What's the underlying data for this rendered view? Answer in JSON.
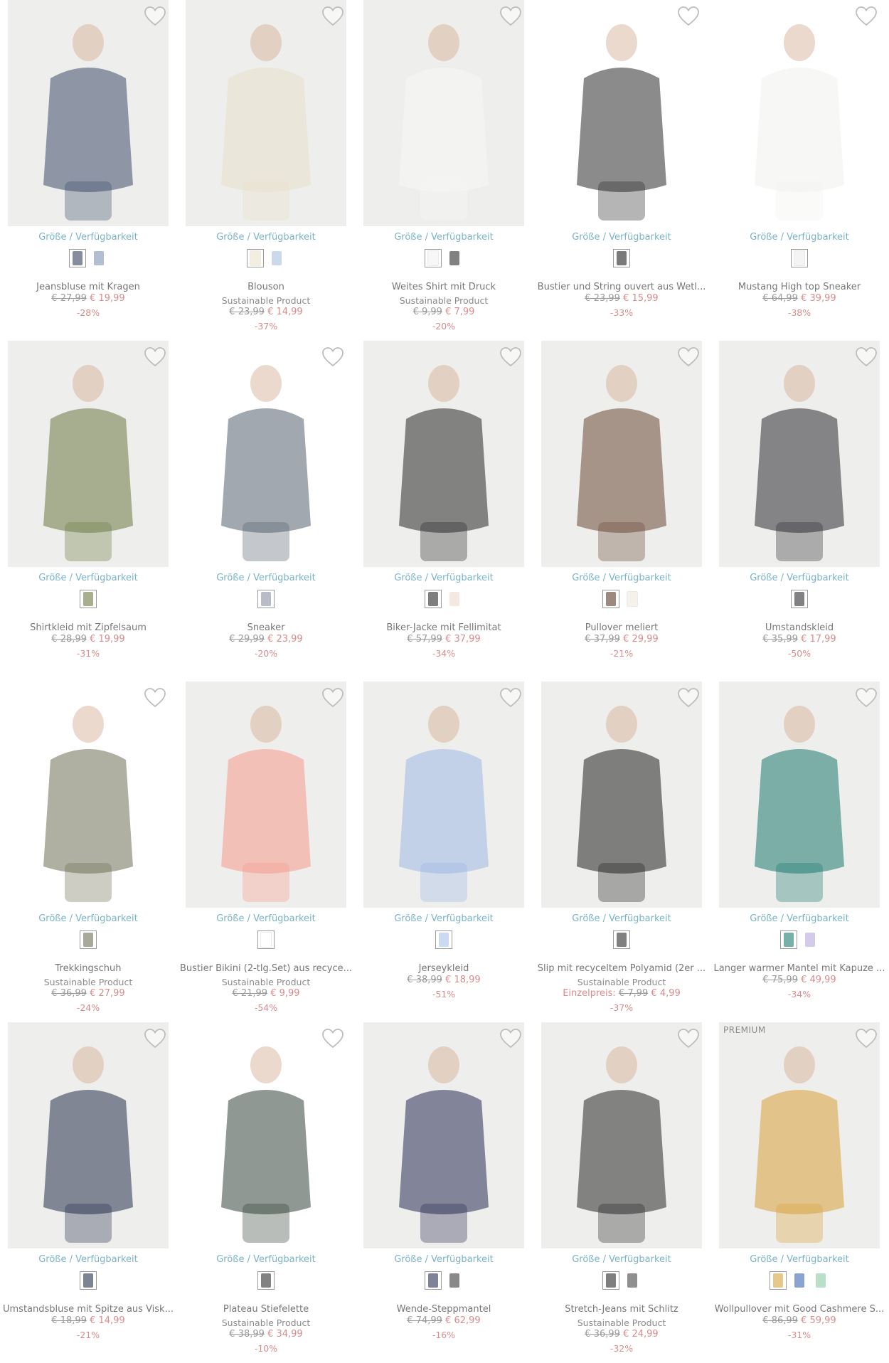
{
  "labels": {
    "size_link": "Größe / Verfügbarkeit",
    "sustainable": "Sustainable Product",
    "premium": "PREMIUM",
    "unit_price": "Einzelpreis:"
  },
  "colors": {
    "price_new": "#d98c8c",
    "link": "#7ab3c9",
    "muted": "#8a8a8a"
  },
  "icons": {
    "wishlist": "heart-outline-icon"
  },
  "products": [
    {
      "name": "Jeansbluse mit Kragen",
      "sustainable": false,
      "old": "€ 27,99",
      "new": "€ 19,99",
      "disc": "-28%",
      "img": "#3f4f6e",
      "bg": "#eeeeec",
      "swatches": [
        "#33415e",
        "#7f93b3"
      ]
    },
    {
      "name": "Blouson",
      "sustainable": true,
      "old": "€ 23,99",
      "new": "€ 14,99",
      "disc": "-37%",
      "img": "#e8e0cc",
      "bg": "#eeeeec",
      "swatches": [
        "#ece3c8",
        "#a9c2dc"
      ]
    },
    {
      "name": "Weites Shirt mit Druck",
      "sustainable": true,
      "old": "€ 9,99",
      "new": "€ 7,99",
      "disc": "-20%",
      "img": "#f7f7f7",
      "bg": "#eeeeec",
      "swatches": [
        "#f3f3f3",
        "#2d2d2d"
      ]
    },
    {
      "name": "Bustier und String ouvert aus Wetl...",
      "sustainable": false,
      "old": "€ 23,99",
      "new": "€ 15,99",
      "disc": "-33%",
      "img": "#2b2b2b",
      "bg": "#ffffff",
      "swatches": [
        "#222222"
      ]
    },
    {
      "name": "Mustang High top Sneaker",
      "sustainable": false,
      "old": "€ 64,99",
      "new": "€ 39,99",
      "disc": "-38%",
      "img": "#f1f1ef",
      "bg": "#ffffff",
      "swatches": [
        "#eeeeee"
      ]
    },
    {
      "name": "Shirtkleid mit Zipfelsaum",
      "sustainable": false,
      "old": "€ 28,99",
      "new": "€ 19,99",
      "disc": "-31%",
      "img": "#6e7a45",
      "bg": "#eeeeec",
      "swatches": [
        "#6e7a45"
      ]
    },
    {
      "name": "Sneaker",
      "sustainable": false,
      "old": "€ 29,99",
      "new": "€ 23,99",
      "disc": "-20%",
      "img": "#556070",
      "bg": "#ffffff",
      "swatches": [
        "#8890a0"
      ]
    },
    {
      "name": "Biker-Jacke mit Fellimitat",
      "sustainable": false,
      "old": "€ 57,99",
      "new": "€ 37,99",
      "disc": "-34%",
      "img": "#2a2a2a",
      "bg": "#eeeeec",
      "swatches": [
        "#2a2a2a",
        "#ecd9cf"
      ]
    },
    {
      "name": "Pullover meliert",
      "sustainable": false,
      "old": "€ 37,99",
      "new": "€ 29,99",
      "disc": "-21%",
      "img": "#6b4a36",
      "bg": "#eeeeec",
      "swatches": [
        "#5b3b2b",
        "#efe9df"
      ]
    },
    {
      "name": "Umstandskleid",
      "sustainable": false,
      "old": "€ 35,99",
      "new": "€ 17,99",
      "disc": "-50%",
      "img": "#2e2e34",
      "bg": "#eeeeec",
      "swatches": [
        "#2e2e34"
      ]
    },
    {
      "name": "Trekkingschuh",
      "sustainable": true,
      "old": "€ 36,99",
      "new": "€ 27,99",
      "disc": "-24%",
      "img": "#6f7056",
      "bg": "#ffffff",
      "swatches": [
        "#6f7056"
      ]
    },
    {
      "name": "Bustier Bikini (2-tlg.Set) aus recyce...",
      "sustainable": true,
      "old": "€ 21,99",
      "new": "€ 9,99",
      "disc": "-54%",
      "img": "#f59a8c",
      "bg": "#eeeeec",
      "swatches": [
        "#ffffff"
      ]
    },
    {
      "name": "Jerseykleid",
      "sustainable": false,
      "old": "€ 38,99",
      "new": "€ 18,99",
      "disc": "-51%",
      "img": "#9fb8e6",
      "bg": "#eeeeec",
      "swatches": [
        "#a9c0ea"
      ]
    },
    {
      "name": "Slip mit recyceltem Polyamid (2er ...",
      "sustainable": true,
      "old": "€ 7,99",
      "new": "€ 4,99",
      "disc": "-37%",
      "unit": true,
      "img": "#232323",
      "bg": "#eeeeec",
      "swatches": [
        "#2b2b2b"
      ]
    },
    {
      "name": "Langer warmer Mantel mit Kapuze ...",
      "sustainable": false,
      "old": "€ 75,99",
      "new": "€ 49,99",
      "disc": "-34%",
      "img": "#1c7a70",
      "bg": "#eeeeec",
      "swatches": [
        "#1c7a70",
        "#b8a7dc"
      ]
    },
    {
      "name": "Umstandsbluse mit Spitze aus Visk...",
      "sustainable": false,
      "old": "€ 18,99",
      "new": "€ 14,99",
      "disc": "-21%",
      "img": "#27324c",
      "bg": "#eeeeec",
      "swatches": [
        "#27324c"
      ]
    },
    {
      "name": "Plateau Stiefelette",
      "sustainable": true,
      "old": "€ 38,99",
      "new": "€ 34,99",
      "disc": "-10%",
      "img": "#34433a",
      "bg": "#ffffff",
      "swatches": [
        "#2f2f2f"
      ]
    },
    {
      "name": "Wende-Steppmantel",
      "sustainable": false,
      "old": "€ 74,99",
      "new": "€ 62,99",
      "disc": "-16%",
      "img": "#2a2f55",
      "bg": "#eeeeec",
      "swatches": [
        "#2a2f55",
        "#3a3a3a"
      ]
    },
    {
      "name": "Stretch-Jeans mit Schlitz",
      "sustainable": true,
      "old": "€ 36,99",
      "new": "€ 24,99",
      "disc": "-32%",
      "img": "#2a2a2a",
      "bg": "#eeeeec",
      "swatches": [
        "#2a2a2a",
        "#444444"
      ]
    },
    {
      "name": "Wollpullover mit Good Cashmere S...",
      "sustainable": false,
      "premium": true,
      "old": "€ 86,99",
      "new": "€ 59,99",
      "disc": "-31%",
      "img": "#d9a33c",
      "bg": "#eeeeec",
      "swatches": [
        "#d9a33c",
        "#3a66b5",
        "#8cc9a4"
      ]
    }
  ]
}
